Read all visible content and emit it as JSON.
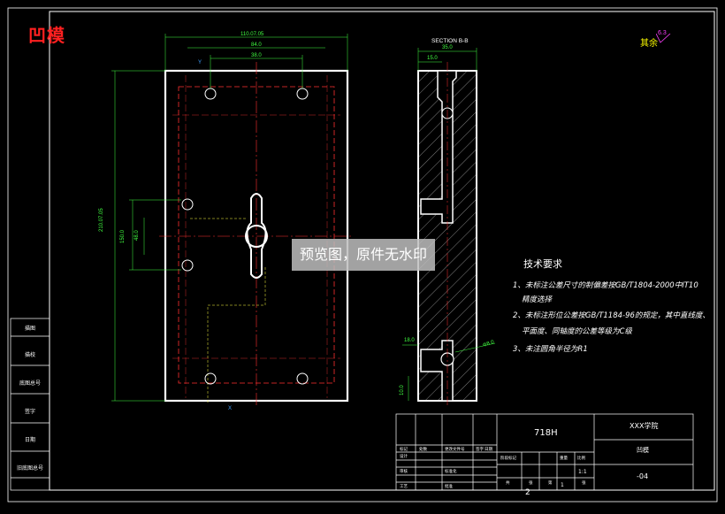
{
  "header": {
    "title": "凹模"
  },
  "watermark": "预览图，原件无水印",
  "front_view": {
    "dims": {
      "overall_width": "110.07.05",
      "hole_span_a": "84.0",
      "hole_span_b": "38.0",
      "overall_height": "210.07.05",
      "hole_span_c": "150.0",
      "slot_span": "48.0"
    },
    "axis_labels": {
      "top": "Y",
      "bottom": "X"
    }
  },
  "section_view": {
    "title": "SECTION B-B",
    "dims": {
      "top_width": "35.0",
      "top_offset": "15.0",
      "left_offset": "18.0",
      "hole_dia": "Φ8.0",
      "bottom_height": "10.0"
    }
  },
  "roughness": {
    "label": "其余",
    "value": "6.3"
  },
  "tech_requirements": {
    "title": "技术要求",
    "lines": [
      "1、未标注公差尺寸的制偏差按GB/T1804-2000中IT10",
      "精度选择",
      "2、未标注形位公差按GB/T1184-96的规定，其中直线度、",
      "平面度、同轴度的公差等级为C级",
      "3、未注圆角半径为R1"
    ]
  },
  "title_block": {
    "material": "718H",
    "company": "XXX学院",
    "part_name": "凹模",
    "drawing_no": "-04",
    "sheet_count": "1",
    "scale": "1:1",
    "sheet": "2",
    "labels": [
      "标记",
      "处数",
      "更改文件号",
      "签字",
      "日期",
      "设计",
      "审核",
      "工艺",
      "标准化",
      "批准",
      "阶段标记",
      "重量",
      "比例",
      "共",
      "张",
      "第",
      "张"
    ]
  },
  "side_table": {
    "labels": [
      "描图",
      "描校",
      "底图总号",
      "签字",
      "日期",
      "旧底图总号"
    ]
  }
}
